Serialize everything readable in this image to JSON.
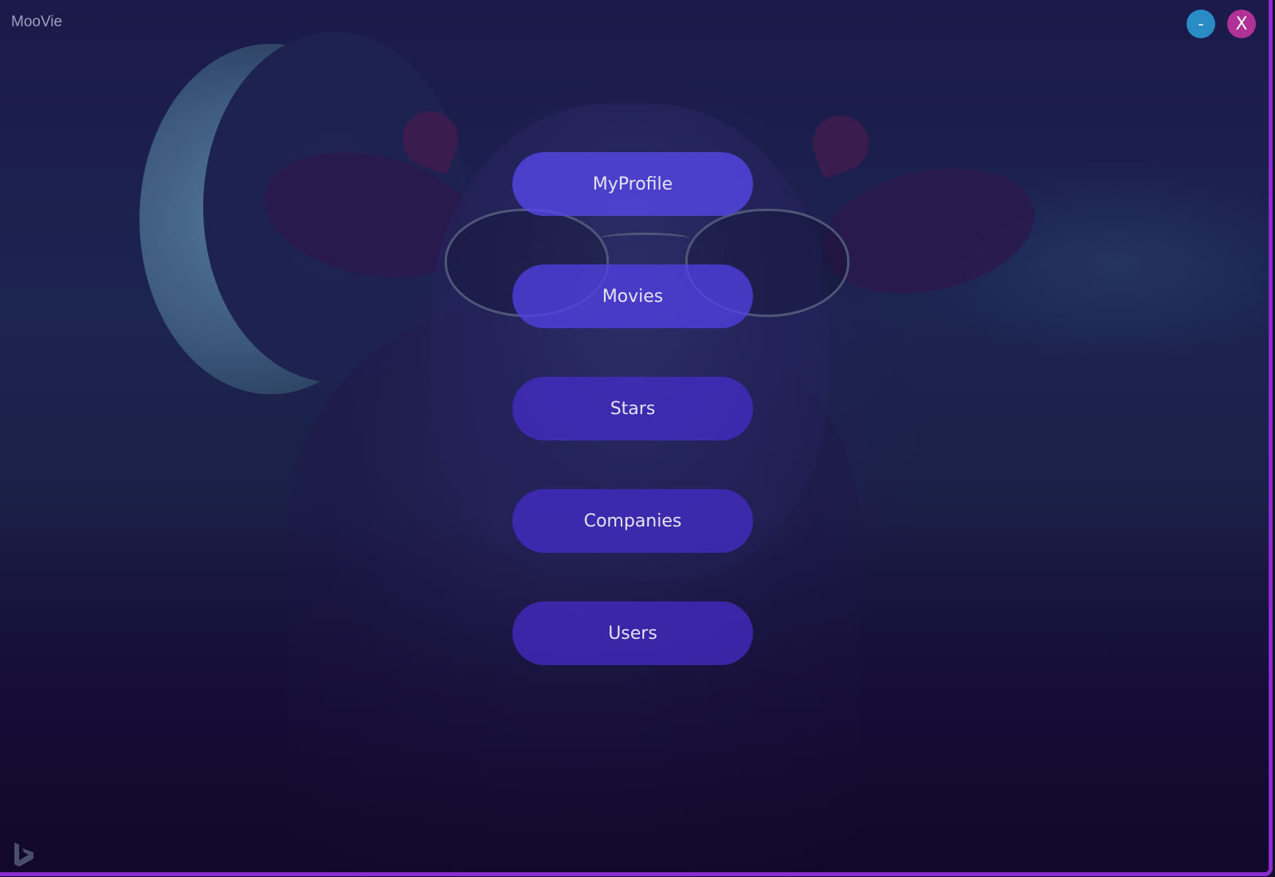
{
  "window": {
    "title": "MooVie",
    "minimize_label": "-",
    "close_label": "X"
  },
  "menu": {
    "items": [
      {
        "label": "MyProfile"
      },
      {
        "label": "Movies"
      },
      {
        "label": "Stars"
      },
      {
        "label": "Companies"
      },
      {
        "label": "Users"
      }
    ]
  },
  "icons": {
    "minimize": "minimize-icon",
    "close": "close-icon",
    "watermark": "bing-logo-icon"
  },
  "colors": {
    "accent_border": "#8a2bd0",
    "minimize_button": "#2a8cc4",
    "close_button": "#b03296",
    "menu_button": "#462dcd"
  }
}
